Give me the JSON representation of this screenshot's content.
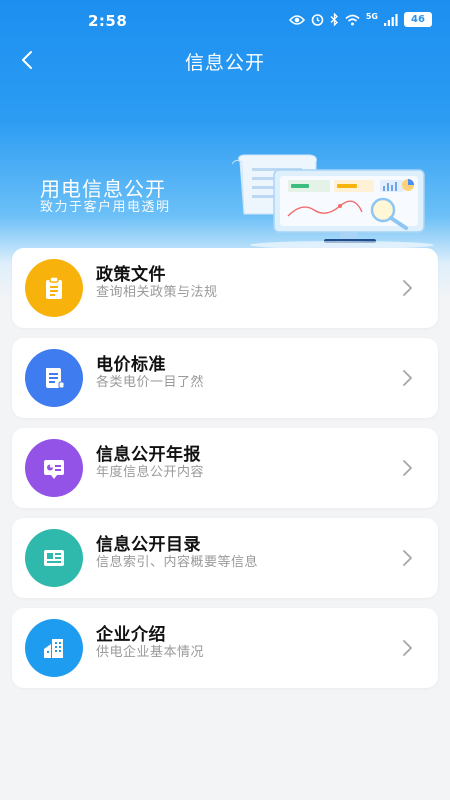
{
  "status_bar": {
    "time": "2:58",
    "network": "5G",
    "battery": "46"
  },
  "header": {
    "title": "信息公开"
  },
  "banner": {
    "title": "用电信息公开",
    "subtitle": "致力于客户用电透明"
  },
  "items": [
    {
      "title": "政策文件",
      "subtitle": "查询相关政策与法规",
      "icon": "document-clipboard-icon",
      "color": "#f7b30c"
    },
    {
      "title": "电价标准",
      "subtitle": "各类电价一目了然",
      "icon": "price-list-icon",
      "color": "#3f7cf0"
    },
    {
      "title": "信息公开年报",
      "subtitle": "年度信息公开内容",
      "icon": "presentation-board-icon",
      "color": "#9353e7"
    },
    {
      "title": "信息公开目录",
      "subtitle": "信息索引、内容概要等信息",
      "icon": "catalog-card-icon",
      "color": "#2fb9ac"
    },
    {
      "title": "企业介绍",
      "subtitle": "供电企业基本情况",
      "icon": "building-icon",
      "color": "#1e9cf0"
    }
  ]
}
